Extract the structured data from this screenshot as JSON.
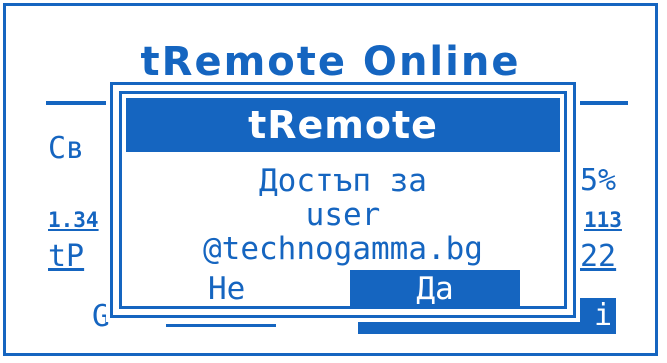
{
  "background": {
    "title": "tRemote Online",
    "row1_left": "Св",
    "row1_right": "5%",
    "row2_left": "1.34",
    "row2_right": "113",
    "row3_left": "tP",
    "row3_right": "22",
    "row4_left": "G",
    "row4_right": "i"
  },
  "dialog": {
    "title": "tRemote",
    "line1": "Достъп за",
    "line2": "user",
    "line3": "@technogamma.bg",
    "no_label": "Не",
    "yes_label": "Да"
  },
  "colors": {
    "accent": "#1565c0",
    "background": "#ffffff"
  }
}
